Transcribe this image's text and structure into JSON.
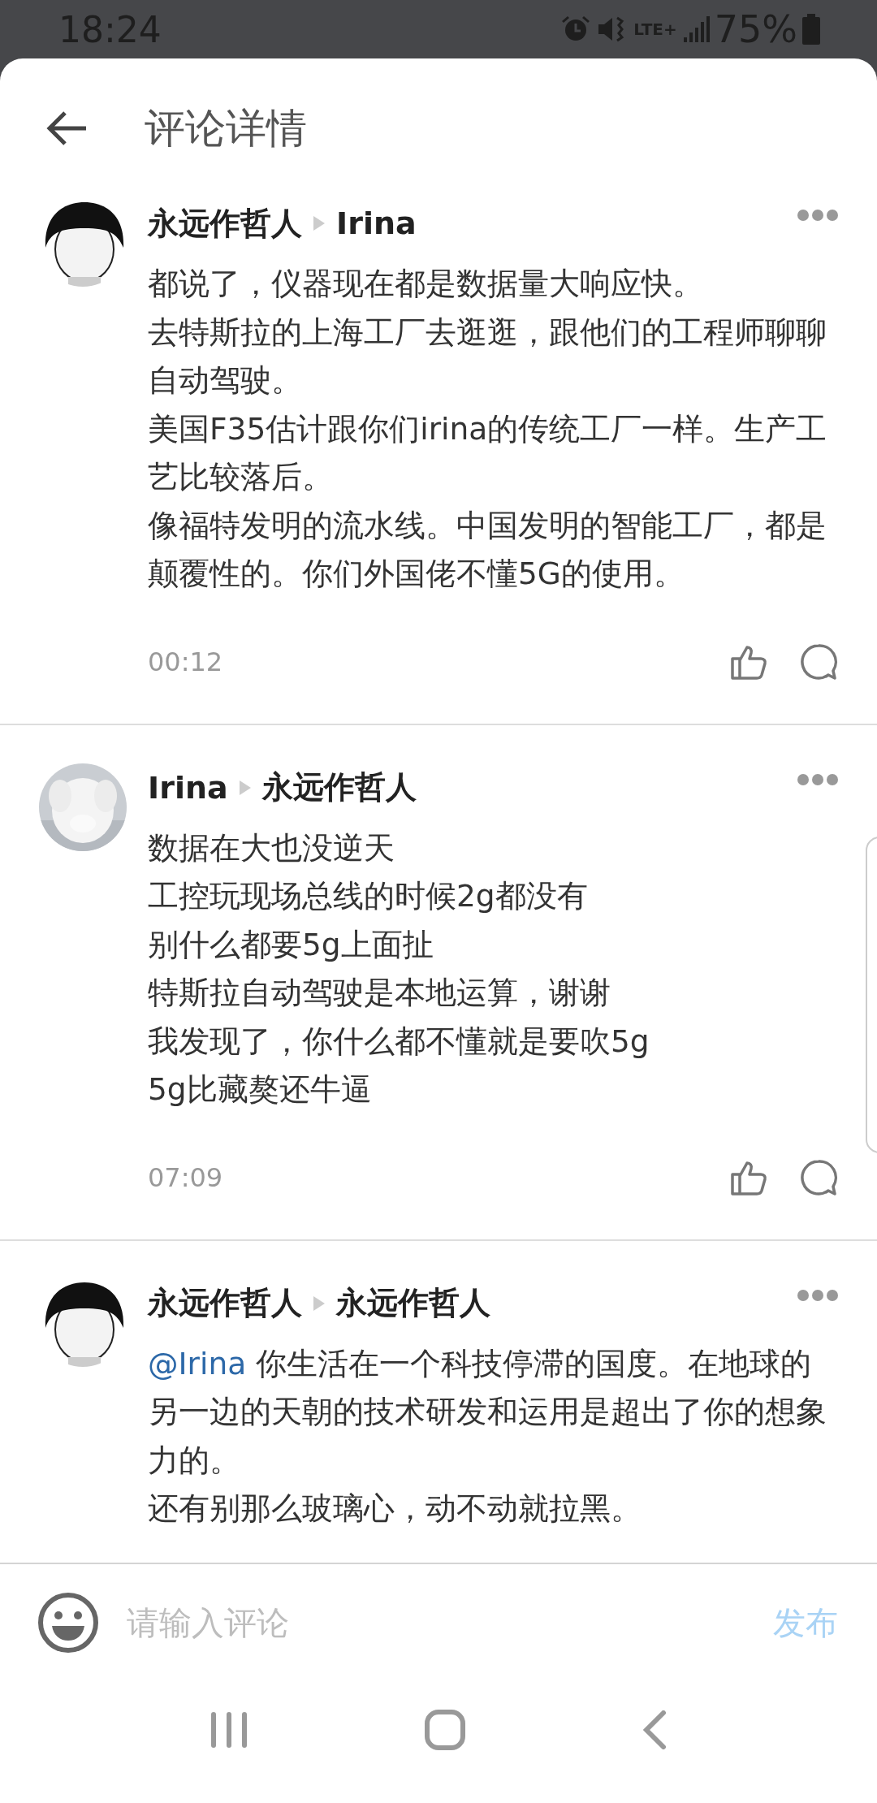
{
  "status_bar": {
    "time": "18:24",
    "network": "LTE+",
    "battery": "75%"
  },
  "header": {
    "title": "评论详情"
  },
  "comments": [
    {
      "avatar": {
        "kind": "cartoon"
      },
      "author": "永远作哲人",
      "reply_to": "Irina",
      "paragraphs": [
        "都说了，仪器现在都是数据量大响应快。",
        "去特斯拉的上海工厂去逛逛，跟他们的工程师聊聊自动驾驶。",
        "美国F35估计跟你们irina的传统工厂一样。生产工艺比较落后。",
        "像福特发明的流水线。中国发明的智能工厂，都是颠覆性的。你们外国佬不懂5G的使用。"
      ],
      "time": "00:12"
    },
    {
      "author": "Irina",
      "reply_to": "永远作哲人",
      "paragraphs": [
        "数据在大也没逆天",
        "工控玩现场总线的时候2g都没有",
        "别什么都要5g上面扯",
        "特斯拉自动驾驶是本地运算，谢谢",
        "我发现了，你什么都不懂就是要吹5g",
        "5g比藏獒还牛逼"
      ],
      "time": "07:09"
    },
    {
      "avatar": {
        "kind": "cartoon"
      },
      "author": "永远作哲人",
      "reply_to": "永远作哲人",
      "mention": "@Irina",
      "paragraphs": [
        "你生活在一个科技停滞的国度。在地球的另一边的天朝的技术研发和运用是超出了你的想象力的。",
        "还有别那么玻璃心，动不动就拉黑。"
      ]
    }
  ],
  "comment_input": {
    "placeholder": "请输入评论",
    "send": "发布"
  }
}
